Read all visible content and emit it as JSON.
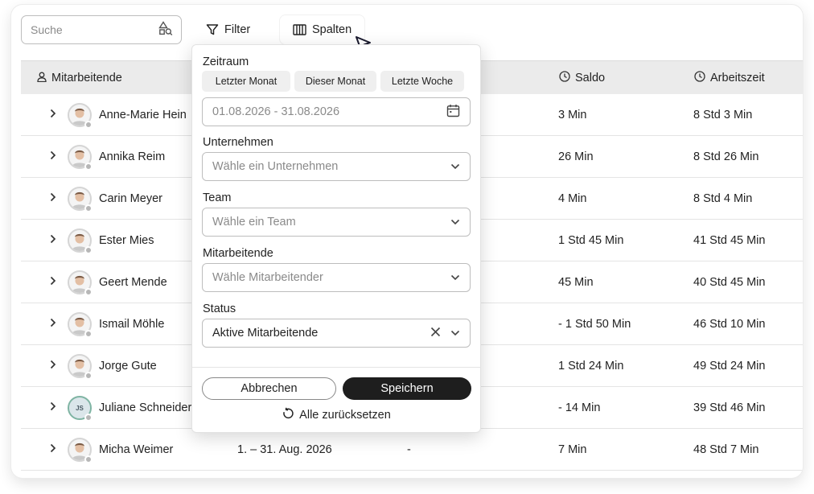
{
  "toolbar": {
    "search_placeholder": "Suche",
    "filter_label": "Filter",
    "columns_label": "Spalten"
  },
  "table": {
    "headers": {
      "employee": "Mitarbeitende",
      "balance": "Saldo",
      "work_time": "Arbeitszeit"
    },
    "rows": [
      {
        "name": "Anne-Marie Hein",
        "period": "",
        "extra": "",
        "balance": "3 Min",
        "work_time": "8 Std 3 Min",
        "initials": ""
      },
      {
        "name": "Annika Reim",
        "period": "",
        "extra": "",
        "balance": "26 Min",
        "work_time": "8 Std 26 Min",
        "initials": ""
      },
      {
        "name": "Carin Meyer",
        "period": "",
        "extra": "",
        "balance": "4 Min",
        "work_time": "8 Std 4 Min",
        "initials": ""
      },
      {
        "name": "Ester Mies",
        "period": "",
        "extra": "",
        "balance": "1 Std 45 Min",
        "work_time": "41 Std 45 Min",
        "initials": ""
      },
      {
        "name": "Geert Mende",
        "period": "",
        "extra": "",
        "balance": "45 Min",
        "work_time": "40 Std 45 Min",
        "initials": ""
      },
      {
        "name": "Ismail Möhle",
        "period": "",
        "extra": "",
        "balance": "- 1 Std 50 Min",
        "work_time": "46 Std 10 Min",
        "initials": ""
      },
      {
        "name": "Jorge Gute",
        "period": "",
        "extra": "",
        "balance": "1 Std 24 Min",
        "work_time": "49 Std 24 Min",
        "initials": ""
      },
      {
        "name": "Juliane Schneider",
        "period": "",
        "extra": "",
        "balance": "- 14 Min",
        "work_time": "39 Std 46 Min",
        "initials": "JS"
      },
      {
        "name": "Micha Weimer",
        "period": "1. – 31. Aug. 2026",
        "extra": "-",
        "balance": "7 Min",
        "work_time": "48 Std 7 Min",
        "initials": ""
      }
    ]
  },
  "filter_popup": {
    "period_label": "Zeitraum",
    "chips": [
      "Letzter Monat",
      "Dieser Monat",
      "Letzte Woche"
    ],
    "date_range_placeholder": "01.08.2026 - 31.08.2026",
    "company_label": "Unternehmen",
    "company_placeholder": "Wähle ein Unternehmen",
    "team_label": "Team",
    "team_placeholder": "Wähle ein Team",
    "employees_label": "Mitarbeitende",
    "employees_placeholder": "Wähle Mitarbeitender",
    "status_label": "Status",
    "status_value": "Aktive Mitarbeitende",
    "cancel_label": "Abbrechen",
    "save_label": "Speichern",
    "reset_label": "Alle zurücksetzen"
  },
  "icons": {
    "search": "search-shapes-icon",
    "filter": "funnel-icon",
    "columns": "columns-icon",
    "employee": "person-icon",
    "clock": "clock-icon",
    "calendar": "calendar-icon",
    "chevron_down": "chevron-down-icon",
    "chevron_right": "chevron-right-icon",
    "clear": "close-icon",
    "reset": "reset-icon"
  },
  "colors": {
    "primary_button": "#1e1e1e",
    "header_bg": "#ebebeb",
    "chip_bg": "#efefef"
  }
}
